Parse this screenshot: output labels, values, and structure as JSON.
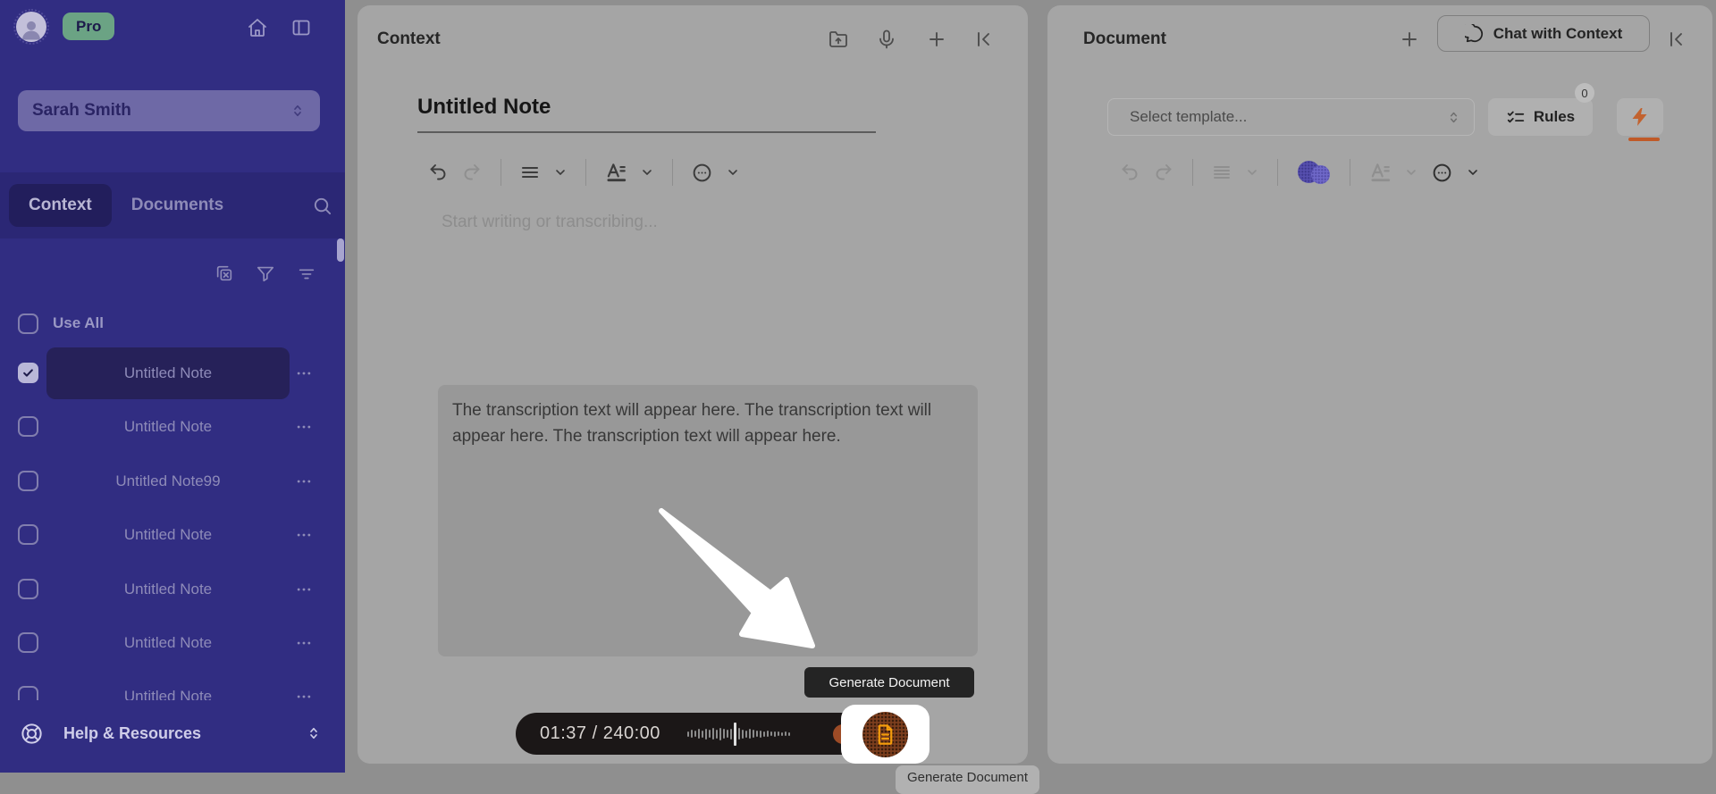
{
  "sidebar": {
    "pro_badge": "Pro",
    "user_name": "Sarah Smith",
    "tabs": {
      "0": {
        "label": "Context"
      },
      "1": {
        "label": "Documents"
      }
    },
    "use_all_label": "Use All",
    "notes": [
      {
        "label": "Untitled Note",
        "checked": true,
        "selected": true
      },
      {
        "label": "Untitled Note",
        "checked": false,
        "selected": false
      },
      {
        "label": "Untitled Note99",
        "checked": false,
        "selected": false
      },
      {
        "label": "Untitled Note",
        "checked": false,
        "selected": false
      },
      {
        "label": "Untitled Note",
        "checked": false,
        "selected": false
      },
      {
        "label": "Untitled Note",
        "checked": false,
        "selected": false
      },
      {
        "label": "Untitled Note",
        "checked": false,
        "selected": false
      }
    ],
    "help_label": "Help & Resources"
  },
  "context_panel": {
    "title": "Context",
    "note_title": "Untitled Note",
    "editor_placeholder": "Start writing or transcribing...",
    "transcription_preview": "The transcription text will appear here. The transcription text will appear here. The transcription text will appear here.",
    "tooltip_label": "Generate Document",
    "recorder_time": "01:37 / 240:00",
    "bottom_button_label": "Generate Document"
  },
  "document_panel": {
    "title": "Document",
    "chat_button_label": "Chat with Context",
    "template_placeholder": "Select template...",
    "rules_label": "Rules",
    "rules_badge": "0"
  },
  "colors": {
    "sidebar_bg": "#312d82",
    "sidebar_band": "#2b2775",
    "active_tab": "#221e5c",
    "selected_row": "#262159",
    "pro_green": "#6ba384",
    "card_bg": "#a5a5a5",
    "page_dim_bg": "#8f8f8f",
    "record_bar": "#1b1717",
    "record_dot": "#9d4b26",
    "generate_accent": "#f39c0c",
    "bolt_orange": "#c2622f",
    "tooltip_bg": "#242424"
  }
}
